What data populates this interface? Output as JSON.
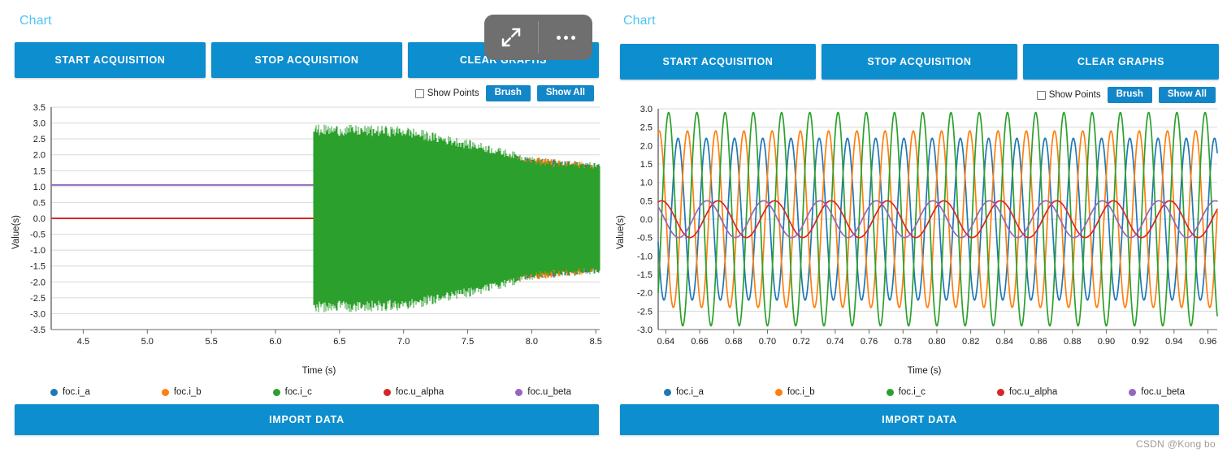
{
  "watermark": "CSDN @Kong bo",
  "overlay": {
    "expand_icon": "expand-icon",
    "more_icon": "more-options-icon"
  },
  "panels": [
    {
      "id": "left",
      "title": "Chart",
      "buttons": [
        {
          "label": "START ACQUISITION",
          "name": "start-acquisition-button"
        },
        {
          "label": "STOP ACQUISITION",
          "name": "stop-acquisition-button"
        },
        {
          "label": "CLEAR GRAPHS",
          "name": "clear-graphs-button"
        }
      ],
      "controls": {
        "show_points_label": "Show Points",
        "show_points_checked": false,
        "brush_label": "Brush",
        "show_all_label": "Show All"
      },
      "import_label": "IMPORT DATA"
    },
    {
      "id": "right",
      "title": "Chart",
      "buttons": [
        {
          "label": "START ACQUISITION",
          "name": "start-acquisition-button"
        },
        {
          "label": "STOP ACQUISITION",
          "name": "stop-acquisition-button"
        },
        {
          "label": "CLEAR GRAPHS",
          "name": "clear-graphs-button"
        }
      ],
      "controls": {
        "show_points_label": "Show Points",
        "show_points_checked": false,
        "brush_label": "Brush",
        "show_all_label": "Show All"
      },
      "import_label": "IMPORT DATA"
    }
  ],
  "colors": {
    "accent": "#0c8ecf",
    "title": "#4ec3f7",
    "overlay": "#6f6f6f",
    "grid": "#d8d8d8",
    "axis": "#6a6a6a",
    "series": {
      "foc.i_a": "#1f77b4",
      "foc.i_b": "#ff7f0e",
      "foc.i_c": "#2ca02c",
      "foc.u_alpha": "#d62728",
      "foc.u_beta": "#9467bd"
    }
  },
  "chart_data": [
    {
      "id": "chart-left",
      "type": "line",
      "title": "Chart",
      "xlabel": "Time (s)",
      "ylabel": "Value(s)",
      "xlim": [
        4.25,
        8.53
      ],
      "ylim": [
        -3.5,
        3.5
      ],
      "xticks": [
        4.5,
        5.0,
        5.5,
        6.0,
        6.5,
        7.0,
        7.5,
        8.0,
        8.5
      ],
      "xtick_labels": [
        "4.5",
        "5.0",
        "5.5",
        "6.0",
        "6.5",
        "7.0",
        "7.5",
        "8.0",
        "8.5"
      ],
      "yticks": [
        3.5,
        3.0,
        2.5,
        2.0,
        1.5,
        1.0,
        0.5,
        0.0,
        -0.5,
        -1.0,
        -1.5,
        -2.0,
        -2.5,
        -3.0,
        -3.5
      ],
      "ytick_labels": [
        "3.5",
        "3.0",
        "2.5",
        "2.0",
        "1.5",
        "1.0",
        "0.5",
        "0.0",
        "-0.5",
        "-1.0",
        "-1.5",
        "-2.0",
        "-2.5",
        "-3.0",
        "-3.5"
      ],
      "grid": true,
      "legend_position": "bottom",
      "description": "High-density time series. Before t=6.30 s all current channels sit flat near 0.00 (noise band +/-0.05) while foc.u_beta holds a constant 1.05. At t=6.30 s acquisition starts and all channels burst into fast oscillation.",
      "event_time": 6.3,
      "series": [
        {
          "name": "foc.i_a",
          "color": "#1f77b4",
          "quiet_value": 0.0,
          "burst_envelope": [
            [
              6.3,
              2.45
            ],
            [
              8.53,
              1.7
            ]
          ],
          "freq_hz": 60
        },
        {
          "name": "foc.i_b",
          "color": "#ff7f0e",
          "quiet_value": 0.0,
          "burst_envelope": [
            [
              6.3,
              2.55
            ],
            [
              8.53,
              1.7
            ]
          ],
          "freq_hz": 60
        },
        {
          "name": "foc.i_c",
          "color": "#2ca02c",
          "quiet_value": 0.0,
          "burst_envelope": [
            [
              6.3,
              2.9
            ],
            [
              7.0,
              2.85
            ],
            [
              7.6,
              2.35
            ],
            [
              8.1,
              1.8
            ],
            [
              8.53,
              1.72
            ]
          ],
          "freq_hz": 60
        },
        {
          "name": "foc.u_alpha",
          "color": "#d62728",
          "quiet_value": 0.0,
          "burst_envelope": [
            [
              6.3,
              0.5
            ],
            [
              7.4,
              0.82
            ],
            [
              8.53,
              1.02
            ]
          ],
          "freq_hz": 30
        },
        {
          "name": "foc.u_beta",
          "color": "#9467bd",
          "quiet_value": 1.05,
          "burst_envelope": [
            [
              6.3,
              0.5
            ],
            [
              7.4,
              0.82
            ],
            [
              8.53,
              1.02
            ]
          ],
          "freq_hz": 30
        }
      ]
    },
    {
      "id": "chart-right",
      "type": "line",
      "title": "Chart",
      "xlabel": "Time (s)",
      "ylabel": "Value(s)",
      "xlim": [
        0.6355,
        0.9655
      ],
      "ylim": [
        -3.0,
        3.0
      ],
      "xticks": [
        0.64,
        0.66,
        0.68,
        0.7,
        0.72,
        0.74,
        0.76,
        0.78,
        0.8,
        0.82,
        0.84,
        0.86,
        0.88,
        0.9,
        0.92,
        0.94,
        0.96
      ],
      "xtick_labels": [
        "0.64",
        "0.66",
        "0.68",
        "0.70",
        "0.72",
        "0.74",
        "0.76",
        "0.78",
        "0.80",
        "0.82",
        "0.84",
        "0.86",
        "0.88",
        "0.90",
        "0.92",
        "0.94",
        "0.96"
      ],
      "yticks": [
        3.0,
        2.5,
        2.0,
        1.5,
        1.0,
        0.5,
        0.0,
        -0.5,
        -1.0,
        -1.5,
        -2.0,
        -2.5,
        -3.0
      ],
      "ytick_labels": [
        "3.0",
        "2.5",
        "2.0",
        "1.5",
        "1.0",
        "0.5",
        "0.0",
        "-0.5",
        "-1.0",
        "-1.5",
        "-2.0",
        "-2.5",
        "-3.0"
      ],
      "grid": true,
      "legend_position": "bottom",
      "description": "Zoomed view of the same acquisition: three-phase sinusoidal currents 120 degrees apart at about 60 Hz, plus two slower half-rate voltage components of small amplitude.",
      "series": [
        {
          "name": "foc.i_a",
          "color": "#1f77b4",
          "waveform": "sine",
          "amplitude": 2.2,
          "freq_hz": 60,
          "phase_deg": 150,
          "offset": 0.0
        },
        {
          "name": "foc.i_b",
          "color": "#ff7f0e",
          "waveform": "sine",
          "amplitude": 2.4,
          "freq_hz": 60,
          "phase_deg": 30,
          "offset": 0.0
        },
        {
          "name": "foc.i_c",
          "color": "#2ca02c",
          "waveform": "sine",
          "amplitude": 2.9,
          "freq_hz": 60,
          "phase_deg": 270,
          "offset": 0.0
        },
        {
          "name": "foc.u_alpha",
          "color": "#d62728",
          "waveform": "sine",
          "amplitude": 0.5,
          "freq_hz": 30,
          "phase_deg": 45,
          "offset": 0.0
        },
        {
          "name": "foc.u_beta",
          "color": "#9467bd",
          "waveform": "sine",
          "amplitude": 0.5,
          "freq_hz": 30,
          "phase_deg": 115,
          "offset": 0.0
        }
      ]
    }
  ],
  "legend": [
    {
      "label": "foc.i_a",
      "color": "#1f77b4"
    },
    {
      "label": "foc.i_b",
      "color": "#ff7f0e"
    },
    {
      "label": "foc.i_c",
      "color": "#2ca02c"
    },
    {
      "label": "foc.u_alpha",
      "color": "#d62728"
    },
    {
      "label": "foc.u_beta",
      "color": "#9467bd"
    }
  ]
}
